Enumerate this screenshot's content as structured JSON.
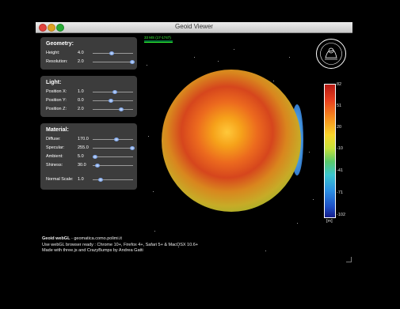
{
  "window": {
    "title": "Geoid Viewer"
  },
  "stats": {
    "text": "33 MS (17-1747)"
  },
  "geometry": {
    "title": "Geometry:",
    "rows": [
      {
        "label": "Height:",
        "value": "4.0",
        "level": 0.48
      },
      {
        "label": "Resolution:",
        "value": "2.0",
        "level": 0.98
      }
    ]
  },
  "light": {
    "title": "Light:",
    "rows": [
      {
        "label": "Position X:",
        "value": "1.0",
        "level": 0.55
      },
      {
        "label": "Position Y:",
        "value": "0.0",
        "level": 0.45
      },
      {
        "label": "Position Z:",
        "value": "2.0",
        "level": 0.7
      }
    ]
  },
  "material": {
    "title": "Material:",
    "rows": [
      {
        "label": "Diffuse:",
        "value": "170.0",
        "level": 0.58
      },
      {
        "label": "Specular:",
        "value": "255.0",
        "level": 0.98
      },
      {
        "label": "Ambient:",
        "value": "5.0",
        "level": 0.05
      },
      {
        "label": "Shiness:",
        "value": "30.0",
        "level": 0.12
      }
    ],
    "normal_scale": {
      "label": "Normal Scale:",
      "value": "1.0",
      "level": 0.2
    }
  },
  "colorbar": {
    "ticks": [
      "82",
      "51",
      "20",
      "-10",
      "-41",
      "-71",
      "-102"
    ],
    "unit": "[m]"
  },
  "credits": {
    "app": "Geoid webGL",
    "site": " - geomatica.como.polimi.it",
    "line2": "Use webGL browser ready : Chrome 10+, Firefox 4+, Safari 5+ & MacOSX 10.6+",
    "line3": "Made with three.js and CrazyBumps by Andrea Gatti"
  },
  "colors": {
    "accent": "#4b7bd6",
    "panel": "#464646",
    "stats": "#3bff3b"
  },
  "icons": [
    "close-icon",
    "minimize-icon",
    "zoom-icon",
    "politecnico-logo"
  ]
}
